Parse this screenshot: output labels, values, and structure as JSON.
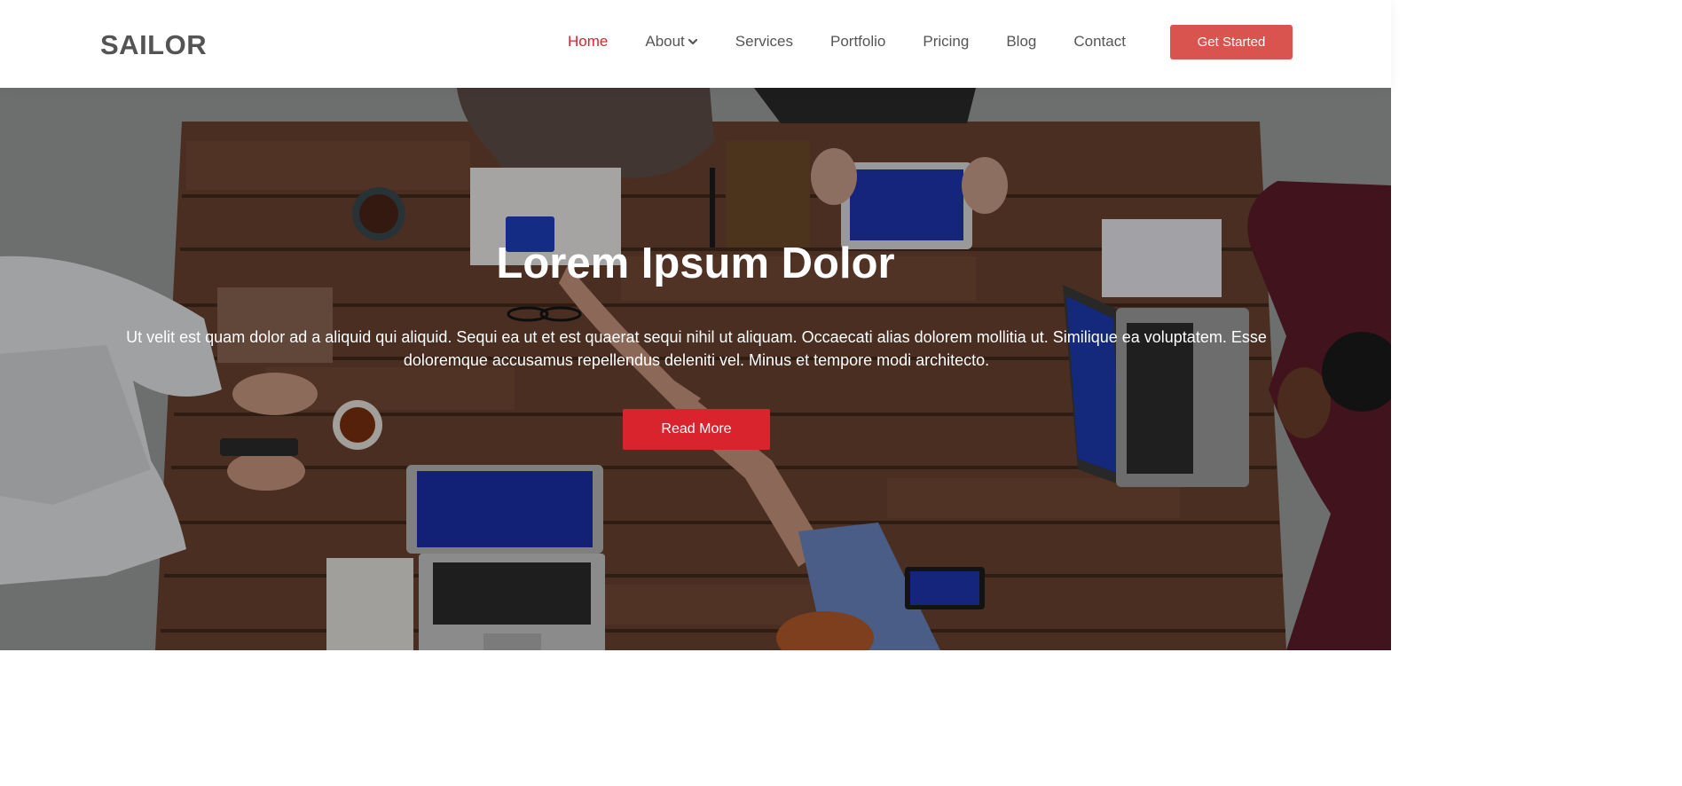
{
  "brand": {
    "name": "SAILOR"
  },
  "nav": {
    "items": [
      {
        "label": "Home",
        "active": true
      },
      {
        "label": "About",
        "has_dropdown": true
      },
      {
        "label": "Services"
      },
      {
        "label": "Portfolio"
      },
      {
        "label": "Pricing"
      },
      {
        "label": "Blog"
      },
      {
        "label": "Contact"
      }
    ],
    "cta_label": "Get Started"
  },
  "hero": {
    "title": "Lorem Ipsum Dolor",
    "text": "Ut velit est quam dolor ad a aliquid qui aliquid. Sequi ea ut et est quaerat sequi nihil ut aliquam. Occaecati alias dolorem mollitia ut. Similique ea voluptatem. Esse doloremque accusamus repellendus deleniti vel. Minus et tempore modi architecto.",
    "button_label": "Read More",
    "background_description_icon": "meeting-table-photo"
  },
  "colors": {
    "accent": "#d9232d",
    "cta_bg": "#d9534f",
    "nav_text": "#555555",
    "logo_text": "#545454"
  }
}
